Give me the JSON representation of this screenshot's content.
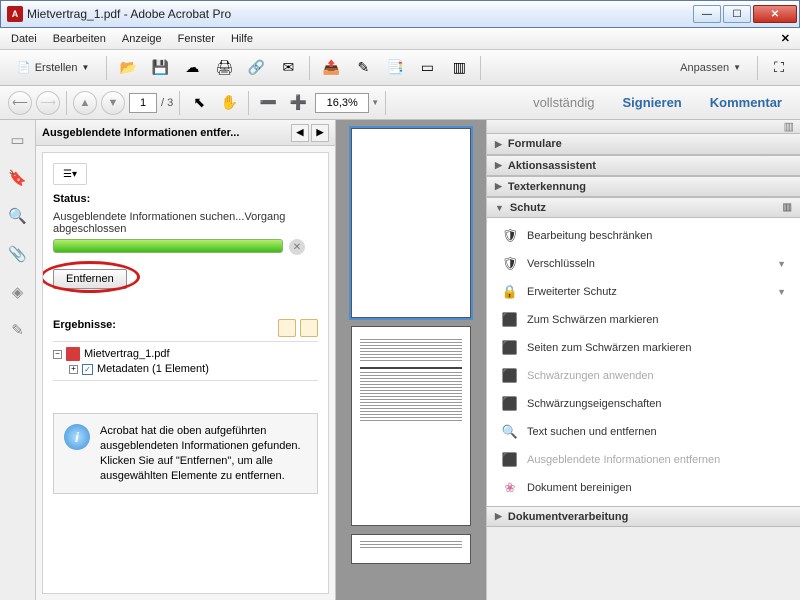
{
  "title": "Mietvertrag_1.pdf - Adobe Acrobat Pro",
  "menu": {
    "file": "Datei",
    "edit": "Bearbeiten",
    "view": "Anzeige",
    "window": "Fenster",
    "help": "Hilfe"
  },
  "toolbar": {
    "create": "Erstellen",
    "customize": "Anpassen"
  },
  "nav": {
    "page": "1",
    "total": "/  3",
    "zoom": "16,3%"
  },
  "links": {
    "full": "vollständig",
    "sign": "Signieren",
    "comment": "Kommentar"
  },
  "panel": {
    "title": "Ausgeblendete Informationen entfer...",
    "status_label": "Status:",
    "status_text": "Ausgeblendete Informationen suchen...Vorgang abgeschlossen",
    "remove": "Entfernen",
    "results": "Ergebnisse:",
    "file": "Mietvertrag_1.pdf",
    "meta": "Metadaten (1 Element)",
    "info": "Acrobat hat die oben aufgeführten ausgeblendeten Informationen gefunden. Klicken Sie auf \"Entfernen\", um alle ausgewählten Elemente zu entfernen."
  },
  "rp": {
    "formulare": "Formulare",
    "aktion": "Aktionsassistent",
    "text": "Texterkennung",
    "schutz": "Schutz",
    "items": {
      "restrict": "Bearbeitung beschränken",
      "encrypt": "Verschlüsseln",
      "advanced": "Erweiterter Schutz",
      "redact": "Zum Schwärzen markieren",
      "redactpages": "Seiten zum Schwärzen markieren",
      "apply": "Schwärzungen anwenden",
      "props": "Schwärzungseigenschaften",
      "search": "Text suchen und entfernen",
      "hidden": "Ausgeblendete Informationen entfernen",
      "sanitize": "Dokument bereinigen"
    },
    "docproc": "Dokumentverarbeitung"
  }
}
